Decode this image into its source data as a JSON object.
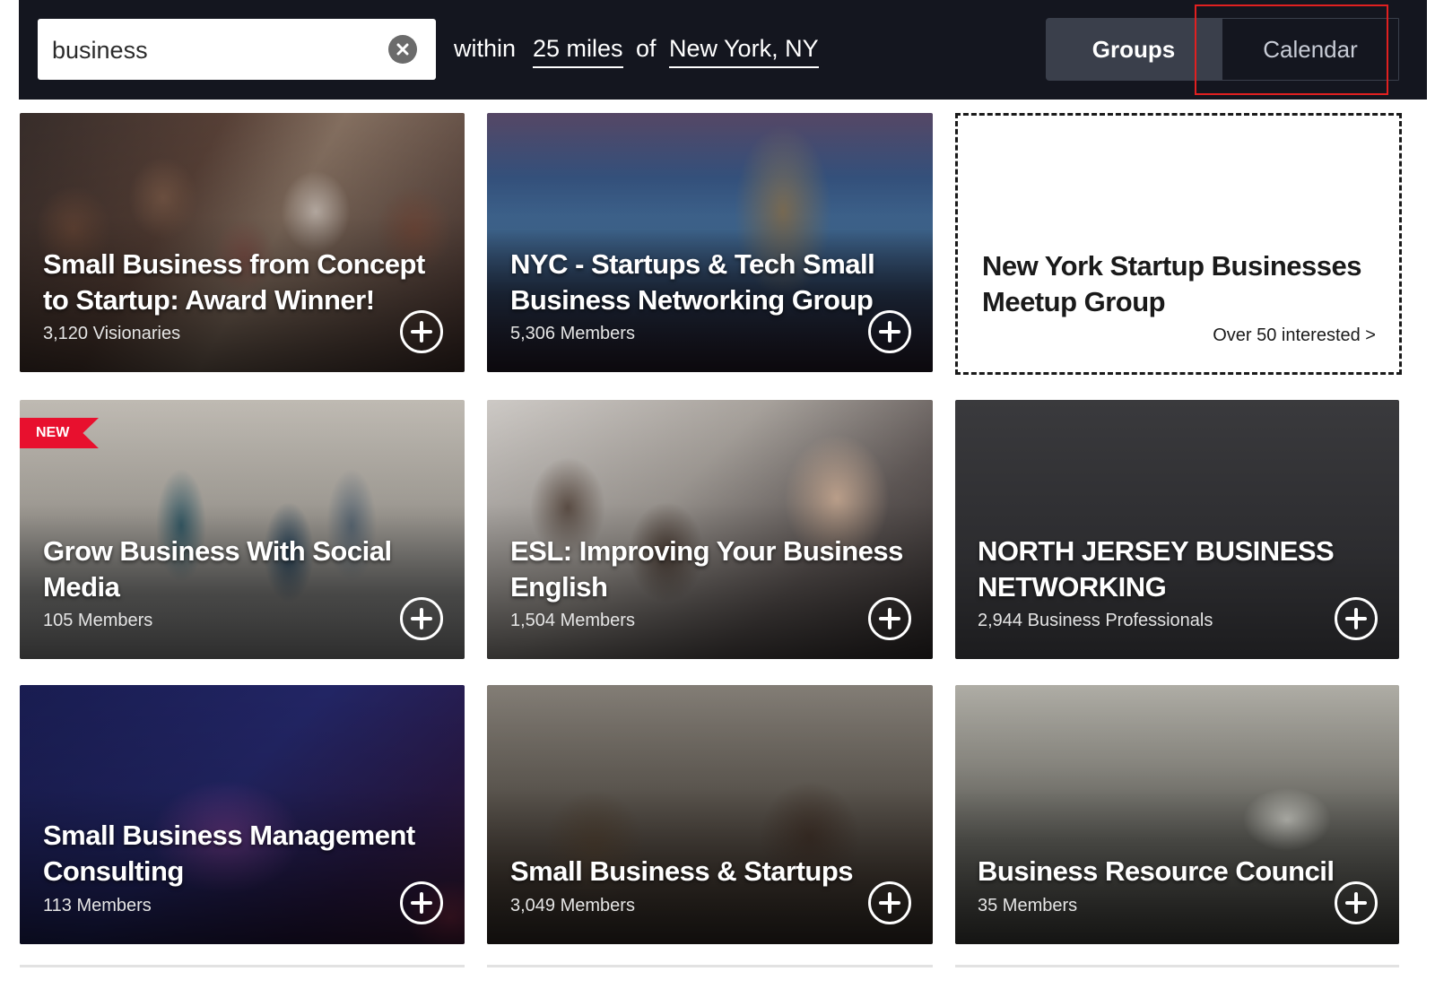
{
  "search": {
    "query": "business",
    "within_label": "within",
    "distance": "25 miles",
    "of_label": "of",
    "location": "New York, NY"
  },
  "view_toggle": {
    "groups_label": "Groups",
    "calendar_label": "Calendar",
    "active": "Groups"
  },
  "colors": {
    "header_bg": "#14161f",
    "highlight": "#e02020",
    "new_badge": "#e8102e"
  },
  "cards": [
    {
      "title_line1": "Small Business from Concept",
      "title_line2": "to Startup: Award Winner!",
      "members": "3,120 Visionaries"
    },
    {
      "title_line1": "NYC - Startups & Tech Small",
      "title_line2": "Business Networking Group",
      "members": "5,306 Members"
    },
    {
      "title_line1": "New York Startup Businesses",
      "title_line2": "Meetup Group",
      "interested": "Over 50 interested >"
    },
    {
      "badge": "NEW",
      "title_line1": "Grow Business With Social",
      "title_line2": "Media",
      "members": "105 Members"
    },
    {
      "title_line1": "ESL: Improving Your Business",
      "title_line2": "English",
      "members": "1,504 Members"
    },
    {
      "title_line1": "NORTH JERSEY BUSINESS",
      "title_line2": "NETWORKING",
      "members": "2,944 Business Professionals"
    },
    {
      "title_line1": "Small Business Management",
      "title_line2": "Consulting",
      "members": "113 Members"
    },
    {
      "title_line1": "Small Business & Startups",
      "members": "3,049 Members"
    },
    {
      "title_line1": "Business Resource Council",
      "members": "35 Members"
    }
  ],
  "icons": {
    "clear": "close-circle-icon",
    "join": "plus-circle-icon"
  }
}
